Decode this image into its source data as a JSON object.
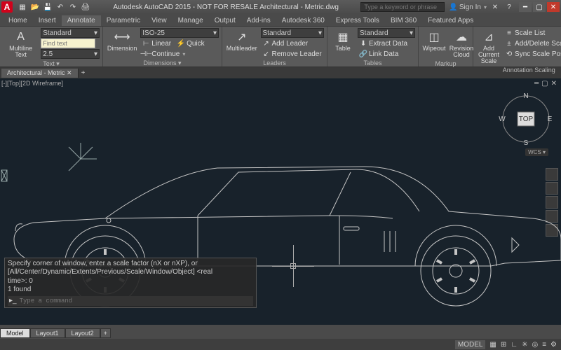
{
  "title": "Autodesk AutoCAD 2015 - NOT FOR RESALE    Architectural - Metric.dwg",
  "app_icon_letter": "A",
  "search_placeholder": "Type a keyword or phrase",
  "signin_label": "Sign In",
  "tabs": [
    "Home",
    "Insert",
    "Annotate",
    "Parametric",
    "View",
    "Manage",
    "Output",
    "Add-ins",
    "Autodesk 360",
    "Express Tools",
    "BIM 360",
    "Featured Apps"
  ],
  "active_tab": "Annotate",
  "panels": {
    "text": {
      "title": "Text ▾",
      "main_btn": "Multiline\nText",
      "style": "Standard",
      "find_placeholder": "Find text",
      "height": "2.5"
    },
    "dimensions": {
      "title": "Dimensions ▾",
      "main_btn": "Dimension",
      "style": "ISO-25",
      "btns": [
        "Linear",
        "Quick",
        "Continue"
      ]
    },
    "leaders": {
      "title": "Leaders",
      "main_btn": "Multileader",
      "style": "Standard",
      "btns": [
        "Add Leader",
        "Remove Leader"
      ]
    },
    "tables": {
      "title": "Tables",
      "main_btn": "Table",
      "style": "Standard",
      "btns": [
        "Extract Data",
        "Link Data"
      ]
    },
    "markup": {
      "title": "Markup",
      "btns": [
        "Wipeout",
        "Revision\nCloud"
      ]
    },
    "annoscale": {
      "title": "Annotation Scaling",
      "main_btn": "Add\nCurrent Scale",
      "btns": [
        "Scale List",
        "Add/Delete Scales",
        "Sync Scale Positions"
      ]
    }
  },
  "filetab": "Architectural - Metric ✕",
  "viewport_label": "[-][Top][2D Wireframe]",
  "compass": {
    "n": "N",
    "s": "S",
    "e": "E",
    "w": "W",
    "center": "TOP"
  },
  "wcs": "WCS ▾",
  "cmd_lines": [
    "Specify corner of window, enter a scale factor (nX or nXP), or",
    "[All/Center/Dynamic/Extents/Previous/Scale/Window/Object] <real",
    "time>: 0",
    "1 found"
  ],
  "cmd_placeholder": "Type a command",
  "bottom_tabs": [
    "Model",
    "Layout1",
    "Layout2"
  ],
  "status_mode": "MODEL"
}
